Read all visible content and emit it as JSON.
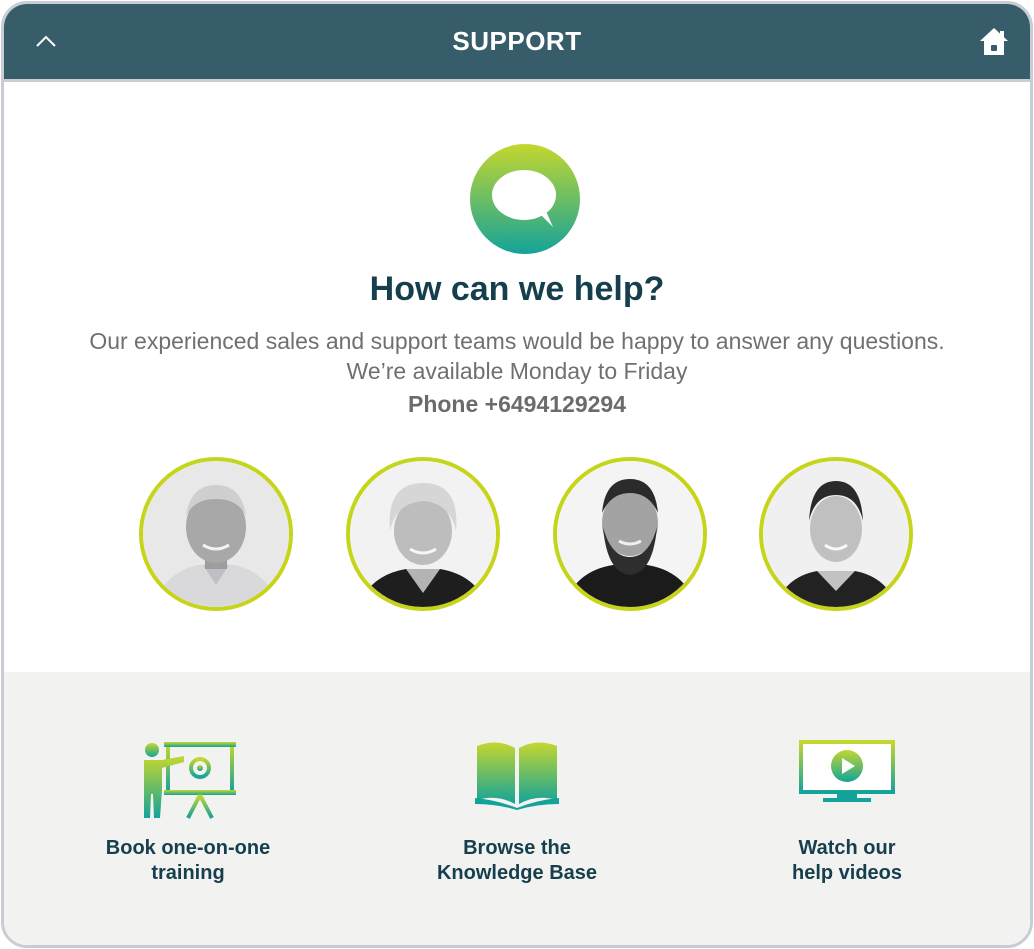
{
  "header": {
    "title": "SUPPORT",
    "collapse_icon": "chevron-up-icon",
    "home_icon": "home-icon"
  },
  "hero": {
    "logo_icon": "chat-bubble-icon",
    "headline": "How can we help?",
    "subtext_line1": "Our experienced sales and support teams would be happy to answer any questions.",
    "subtext_line2": "We’re available Monday to Friday",
    "phone": "Phone +6494129294"
  },
  "team": [
    {
      "photo": "team-member-photo-1"
    },
    {
      "photo": "team-member-photo-2"
    },
    {
      "photo": "team-member-photo-3"
    },
    {
      "photo": "team-member-photo-4"
    }
  ],
  "actions": [
    {
      "icon": "presentation-training-icon",
      "line1": "Book one-on-one",
      "line2": "training"
    },
    {
      "icon": "open-book-icon",
      "line1": "Browse the",
      "line2": "Knowledge Base"
    },
    {
      "icon": "video-monitor-icon",
      "line1": "Watch our",
      "line2": "help videos"
    }
  ],
  "colors": {
    "header_bg": "#375d6b",
    "headline": "#163f4e",
    "accent_ring": "#c6d41a",
    "gradient_top": "#c4d72e",
    "gradient_bottom": "#14a39a",
    "bottom_bg": "#f2f2f0"
  }
}
